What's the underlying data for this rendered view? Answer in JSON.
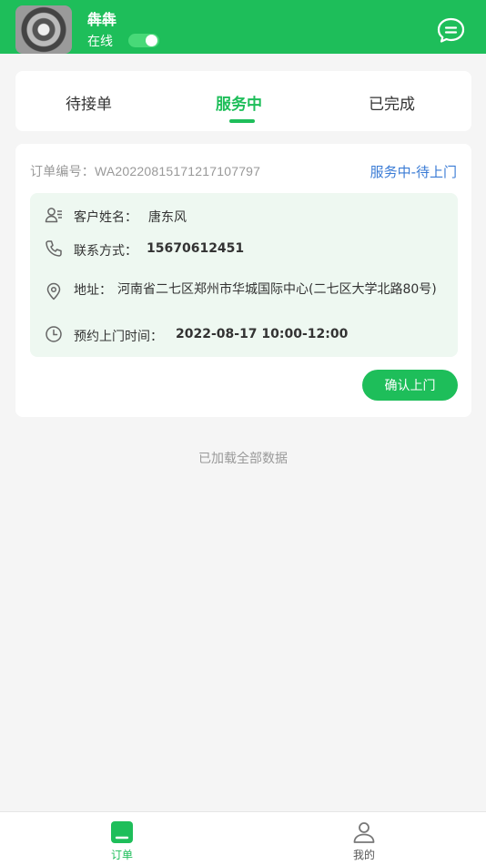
{
  "header": {
    "user_name": "犇犇",
    "status_label": "在线",
    "online": true
  },
  "tabs": [
    {
      "label": "待接单",
      "active": false
    },
    {
      "label": "服务中",
      "active": true
    },
    {
      "label": "已完成",
      "active": false
    }
  ],
  "order": {
    "order_no": "订单编号：WA20220815171217107797",
    "status": "服务中-待上门",
    "customer_label": "客户姓名：",
    "customer_name": "唐东风",
    "phone_label": "联系方式：",
    "phone": "15670612451",
    "address_label": "地址：",
    "address": "河南省二七区郑州市华城国际中心(二七区大学北路80号)",
    "time_label": "预约上门时间：",
    "time": "2022-08-17 10:00-12:00",
    "confirm_label": "确认上门"
  },
  "loaded_tip": "已加载全部数据",
  "bottom_nav": [
    {
      "label": "订单",
      "icon": "order-icon",
      "active": true
    },
    {
      "label": "我的",
      "icon": "user-icon",
      "active": false
    }
  ],
  "colors": {
    "brand": "#1ebe5a",
    "status_blue": "#3a7bd5",
    "info_bg": "#eef8f1"
  }
}
